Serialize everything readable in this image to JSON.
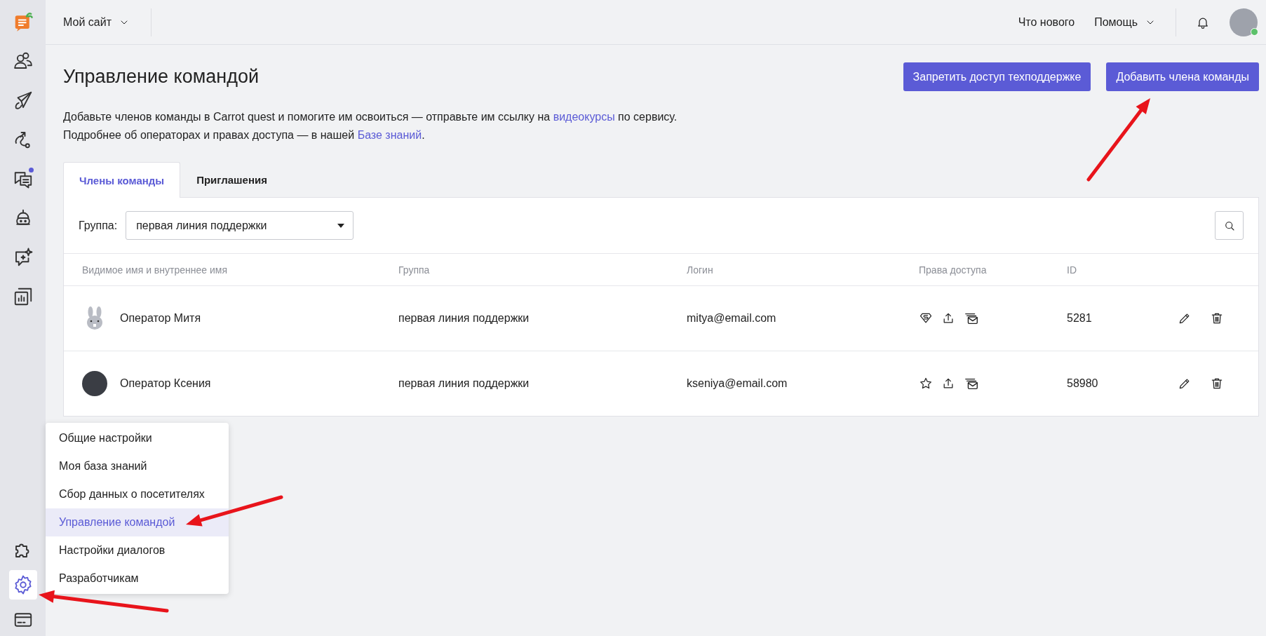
{
  "sidebar": {
    "items": [
      {
        "selected": false,
        "badge": false
      },
      {
        "selected": false,
        "badge": false
      },
      {
        "selected": false,
        "badge": false
      },
      {
        "selected": false,
        "badge": false
      },
      {
        "selected": false,
        "badge": true
      },
      {
        "selected": false,
        "badge": false
      },
      {
        "selected": false,
        "badge": false
      },
      {
        "selected": false,
        "badge": false
      }
    ],
    "bottom_items": [
      {
        "selected": false
      },
      {
        "selected": true
      },
      {
        "selected": false
      }
    ]
  },
  "header": {
    "site": "Мой сайт",
    "links": [
      {
        "label": "Что нового",
        "dropdown": false
      },
      {
        "label": "Помощь",
        "dropdown": true
      }
    ],
    "user_online": true
  },
  "page": {
    "title": "Управление командой",
    "buttons": [
      "Запретить доступ техподдержке",
      "Добавить члена команды"
    ],
    "intro": [
      {
        "before": "Добавьте членов команды в Carrot quest и помогите им освоиться — отправьте им ссылку на ",
        "link": "видеокурсы",
        "after": " по сервису."
      },
      {
        "before": "Подробнее об операторах и правах доступа — в нашей ",
        "link": "Базе знаний",
        "after": "."
      }
    ]
  },
  "tabs": [
    {
      "label": "Члены команды",
      "selected": true
    },
    {
      "label": "Приглашения",
      "selected": false
    }
  ],
  "filter": {
    "label": "Группа:",
    "value": "первая линия поддержки"
  },
  "table": {
    "columns": [
      "Видимое имя и внутреннее имя",
      "Группа",
      "Логин",
      "Права доступа",
      "ID"
    ],
    "rows": [
      {
        "avatar": {
          "kind": "rabbit"
        },
        "name": "Оператор Митя",
        "group": "первая линия поддержки",
        "login": "mitya@email.com",
        "role": {
          "kind": "owner"
        },
        "id": "5281"
      },
      {
        "avatar": {
          "kind": "photo"
        },
        "name": "Оператор Ксения",
        "group": "первая линия поддержки",
        "login": "kseniya@email.com",
        "role": {
          "kind": "admin"
        },
        "id": "58980"
      }
    ]
  },
  "settings_menu": {
    "items": [
      {
        "label": "Общие настройки",
        "selected": false
      },
      {
        "label": "Моя база знаний",
        "selected": false
      },
      {
        "label": "Сбор данных о посетителях",
        "selected": false
      },
      {
        "label": "Управление командой",
        "selected": true
      },
      {
        "label": "Настройки диалогов",
        "selected": false
      },
      {
        "label": "Разработчикам",
        "selected": false
      }
    ]
  }
}
